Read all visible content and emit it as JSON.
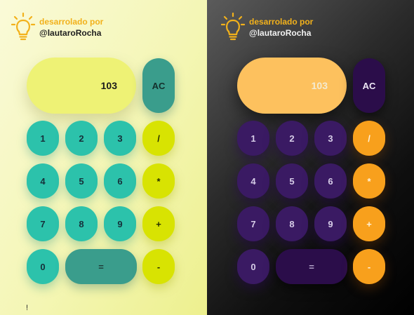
{
  "brand": {
    "line1": "desarrolado por",
    "line2": "@lautaroRocha",
    "icon": "lightbulb-icon",
    "accent_color": "#f2b11b"
  },
  "calculator": {
    "display_value": "103",
    "clear_label": "AC",
    "keys": {
      "one": "1",
      "two": "2",
      "three": "3",
      "divide": "/",
      "four": "4",
      "five": "5",
      "six": "6",
      "multiply": "*",
      "seven": "7",
      "eight": "8",
      "nine": "9",
      "add": "+",
      "zero": "0",
      "equals": "=",
      "subtract": "-"
    }
  },
  "footer": {
    "mark": "!"
  },
  "themes": {
    "light": {
      "display": "#eef275",
      "number_keys": "#2cc2ab",
      "operator_keys": "#d8e302",
      "ac_equals": "#3a9d8c"
    },
    "dark": {
      "display": "#fdc15e",
      "number_keys": "#3a1a63",
      "operator_keys": "#f8a01c",
      "ac_equals": "#2b0d4a"
    }
  }
}
